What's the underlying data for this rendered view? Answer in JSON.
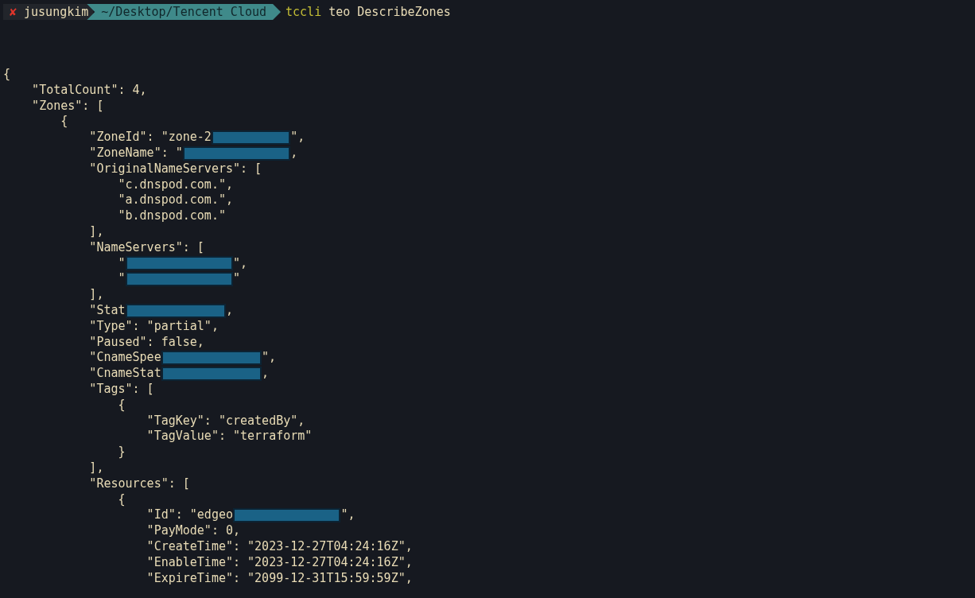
{
  "prompt": {
    "status": "✘",
    "user": "jusungkim",
    "path": "~/Desktop/Tencent Cloud",
    "command": "tccli",
    "args": "teo DescribeZones"
  },
  "output": [
    {
      "parts": [
        {
          "kind": "text",
          "text": "{"
        }
      ],
      "children": [
        {
          "parts": [
            {
              "kind": "text",
              "text": "\"TotalCount\": 4,"
            }
          ]
        },
        {
          "parts": [
            {
              "kind": "text",
              "text": "\"Zones\": ["
            }
          ],
          "children": [
            {
              "parts": [
                {
                  "kind": "text",
                  "text": "{"
                }
              ],
              "children": [
                {
                  "parts": [
                    {
                      "kind": "text",
                      "text": "\"ZoneId\": \"zone-2"
                    },
                    {
                      "kind": "redacted"
                    },
                    {
                      "kind": "text",
                      "text": "\","
                    }
                  ]
                },
                {
                  "parts": [
                    {
                      "kind": "text",
                      "text": "\"ZoneName\": \""
                    },
                    {
                      "kind": "redacted"
                    },
                    {
                      "kind": "text",
                      "text": ","
                    }
                  ]
                },
                {
                  "parts": [
                    {
                      "kind": "text",
                      "text": "\"OriginalNameServers\": ["
                    }
                  ],
                  "children": [
                    {
                      "parts": [
                        {
                          "kind": "text",
                          "text": "\"c.dnspod.com.\","
                        }
                      ]
                    },
                    {
                      "parts": [
                        {
                          "kind": "text",
                          "text": "\"a.dnspod.com.\","
                        }
                      ]
                    },
                    {
                      "parts": [
                        {
                          "kind": "text",
                          "text": "\"b.dnspod.com.\""
                        }
                      ]
                    }
                  ]
                },
                {
                  "parts": [
                    {
                      "kind": "text",
                      "text": "],"
                    }
                  ]
                },
                {
                  "parts": [
                    {
                      "kind": "text",
                      "text": "\"NameServers\": ["
                    }
                  ],
                  "children": [
                    {
                      "parts": [
                        {
                          "kind": "text",
                          "text": "\""
                        },
                        {
                          "kind": "redacted"
                        },
                        {
                          "kind": "text",
                          "text": "\","
                        }
                      ]
                    },
                    {
                      "parts": [
                        {
                          "kind": "text",
                          "text": "\""
                        },
                        {
                          "kind": "redacted"
                        },
                        {
                          "kind": "text",
                          "text": "\""
                        }
                      ]
                    }
                  ]
                },
                {
                  "parts": [
                    {
                      "kind": "text",
                      "text": "],"
                    }
                  ]
                },
                {
                  "parts": [
                    {
                      "kind": "text",
                      "text": "\"Stat"
                    },
                    {
                      "kind": "redacted"
                    },
                    {
                      "kind": "text",
                      "text": ","
                    }
                  ]
                },
                {
                  "parts": [
                    {
                      "kind": "text",
                      "text": "\"Type\": \"partial\","
                    }
                  ]
                },
                {
                  "parts": [
                    {
                      "kind": "text",
                      "text": "\"Paused\": false,"
                    }
                  ]
                },
                {
                  "parts": [
                    {
                      "kind": "text",
                      "text": "\"CnameSpee"
                    },
                    {
                      "kind": "redacted"
                    },
                    {
                      "kind": "text",
                      "text": "\","
                    }
                  ]
                },
                {
                  "parts": [
                    {
                      "kind": "text",
                      "text": "\"CnameStat"
                    },
                    {
                      "kind": "redacted"
                    },
                    {
                      "kind": "text",
                      "text": ","
                    }
                  ]
                },
                {
                  "parts": [
                    {
                      "kind": "text",
                      "text": "\"Tags\": ["
                    }
                  ],
                  "children": [
                    {
                      "parts": [
                        {
                          "kind": "text",
                          "text": "{"
                        }
                      ],
                      "children": [
                        {
                          "parts": [
                            {
                              "kind": "text",
                              "text": "\"TagKey\": \"createdBy\","
                            }
                          ]
                        },
                        {
                          "parts": [
                            {
                              "kind": "text",
                              "text": "\"TagValue\": \"terraform\""
                            }
                          ]
                        }
                      ]
                    },
                    {
                      "parts": [
                        {
                          "kind": "text",
                          "text": "}"
                        }
                      ]
                    }
                  ]
                },
                {
                  "parts": [
                    {
                      "kind": "text",
                      "text": "],"
                    }
                  ]
                },
                {
                  "parts": [
                    {
                      "kind": "text",
                      "text": "\"Resources\": ["
                    }
                  ],
                  "children": [
                    {
                      "parts": [
                        {
                          "kind": "text",
                          "text": "{"
                        }
                      ],
                      "children": [
                        {
                          "parts": [
                            {
                              "kind": "text",
                              "text": "\"Id\": \"edgeo"
                            },
                            {
                              "kind": "redacted"
                            },
                            {
                              "kind": "text",
                              "text": "\","
                            }
                          ]
                        },
                        {
                          "parts": [
                            {
                              "kind": "text",
                              "text": "\"PayMode\": 0,"
                            }
                          ]
                        },
                        {
                          "parts": [
                            {
                              "kind": "text",
                              "text": "\"CreateTime\": \"2023-12-27T04:24:16Z\","
                            }
                          ]
                        },
                        {
                          "parts": [
                            {
                              "kind": "text",
                              "text": "\"EnableTime\": \"2023-12-27T04:24:16Z\","
                            }
                          ]
                        },
                        {
                          "parts": [
                            {
                              "kind": "text",
                              "text": "\"ExpireTime\": \"2099-12-31T15:59:59Z\","
                            }
                          ]
                        }
                      ]
                    }
                  ]
                }
              ]
            }
          ]
        }
      ]
    }
  ]
}
